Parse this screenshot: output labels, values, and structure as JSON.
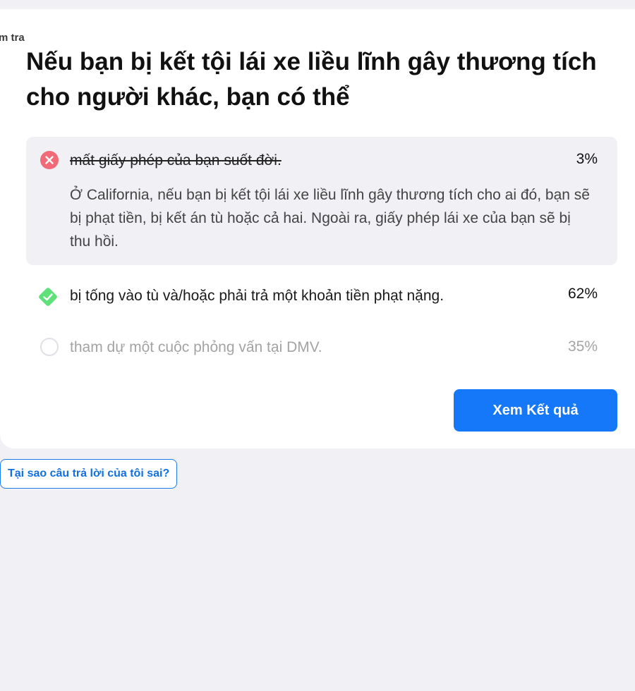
{
  "card": {
    "tag": "m tra",
    "question": "Nếu bạn bị kết tội lái xe liều lĩnh gây thương tích cho người khác, bạn có thể"
  },
  "options": [
    {
      "text": "mất giấy phép của bạn suốt đời.",
      "percent": "3%",
      "state": "wrong",
      "icon": "x-circle-icon",
      "color": "#f06a78",
      "explanation": "Ở California, nếu bạn bị kết tội lái xe liều lĩnh gây thương tích cho ai đó, bạn sẽ bị phạt tiền, bị kết án tù hoặc cả hai. Ngoài ra, giấy phép lái xe của bạn sẽ bị thu hồi."
    },
    {
      "text": "bị tống vào tù và/hoặc phải trả một khoản tiền phạt nặng.",
      "percent": "62%",
      "state": "correct",
      "icon": "check-diamond-icon",
      "color": "#5ee07a"
    },
    {
      "text": "tham dự một cuộc phỏng vấn tại DMV.",
      "percent": "35%",
      "state": "unselected",
      "icon": "empty-circle-icon",
      "color": "#e0e0e6"
    }
  ],
  "actions": {
    "results_label": "Xem Kết quả",
    "why_label": "Tại sao câu trả lời của tôi sai?"
  },
  "colors": {
    "accent": "#1478f8",
    "background": "#f0f0f5",
    "card": "#ffffff"
  }
}
